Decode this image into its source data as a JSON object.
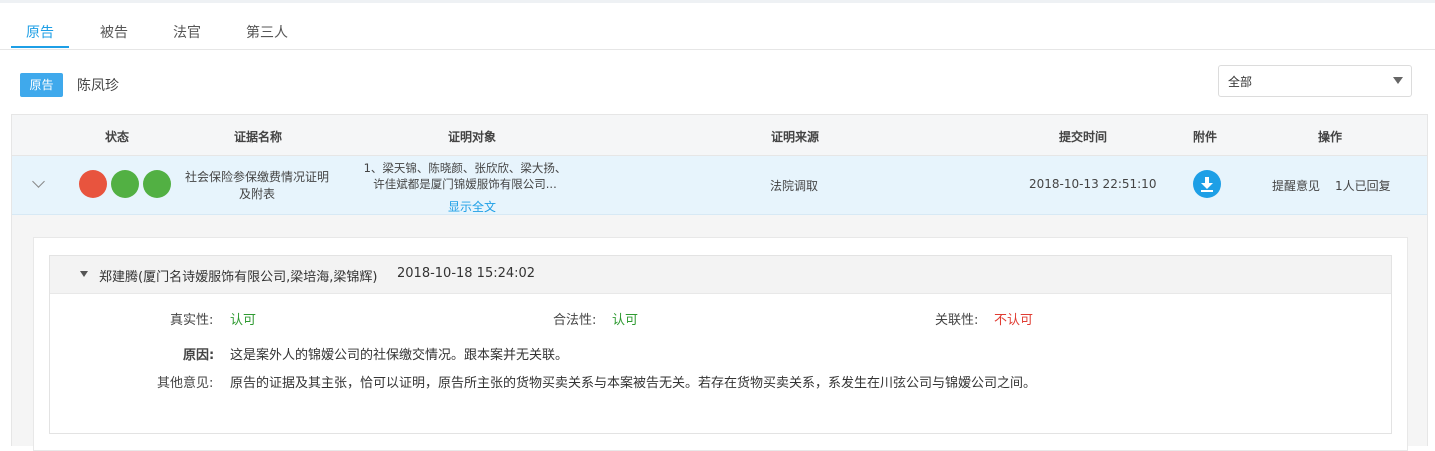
{
  "tabs": [
    {
      "label": "原告",
      "active": true
    },
    {
      "label": "被告",
      "active": false
    },
    {
      "label": "法官",
      "active": false
    },
    {
      "label": "第三人",
      "active": false
    }
  ],
  "party": {
    "badge": "原告",
    "name": "陈凤珍"
  },
  "filter": {
    "selected": "全部"
  },
  "table": {
    "headers": [
      "状态",
      "证据名称",
      "证明对象",
      "证明来源",
      "提交时间",
      "附件",
      "操作"
    ],
    "rows": [
      {
        "status_dots": [
          "red",
          "green",
          "green"
        ],
        "evidence_name": "社会保险参保缴费情况证明及附表",
        "target_line1": "1、梁天锦、陈晓颜、张欣欣、梁大扬、",
        "target_line2": "许佳斌都是厦门锦嫒服饰有限公司...",
        "show_all": "显示全文",
        "source": "法院调取",
        "submit_time": "2018-10-13 22:51:10",
        "attachment_icon": "download-icon",
        "op_remind": "提醒意见",
        "op_replied": "1人已回复"
      }
    ]
  },
  "opinion": {
    "author": "郑建腾(厦门名诗嫒服饰有限公司,梁培海,梁锦辉)",
    "date": "2018-10-18 15:24:02",
    "authenticity_label": "真实性:",
    "authenticity_value": "认可",
    "legality_label": "合法性:",
    "legality_value": "认可",
    "relevance_label": "关联性:",
    "relevance_value": "不认可",
    "reason_label": "原因:",
    "reason_text": "这是案外人的锦嫒公司的社保缴交情况。跟本案并无关联。",
    "other_label": "其他意见:",
    "other_text": "原告的证据及其主张，恰可以证明，原告所主张的货物买卖关系与本案被告无关。若存在货物买卖关系，系发生在川弦公司与锦嫒公司之间。"
  },
  "colors": {
    "accent": "#1e9fe6",
    "status_red": "#e8543e",
    "status_green": "#52b043",
    "ok_green": "#2e9a31",
    "bad_red": "#e03c32"
  }
}
